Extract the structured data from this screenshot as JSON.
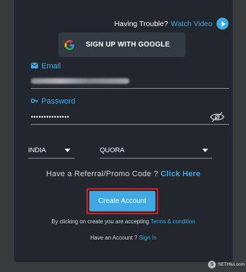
{
  "header": {
    "trouble_text": "Having Trouble?",
    "watch_link": "Watch Video"
  },
  "google_button": {
    "label": "SIGN UP WITH GOOGLE"
  },
  "email": {
    "label": "Email",
    "value_blurred": true
  },
  "password": {
    "label": "Password",
    "value": "•••••••••••••••"
  },
  "country_select": {
    "selected": "INDIA"
  },
  "source_select": {
    "selected": "QUORA"
  },
  "referral": {
    "prompt": "Have a Referral/Promo Code ?",
    "link": "Click Here"
  },
  "create_button": {
    "label": "Create Account"
  },
  "terms": {
    "prefix": "By clicking on create you are accepting",
    "link": "Terms & condition"
  },
  "signin": {
    "prefix": "Have an Account ?",
    "link": "Sign In"
  },
  "watermark": {
    "text": "SETHlui.com"
  },
  "colors": {
    "accent": "#3fa9e6",
    "panel": "#22272d",
    "background": "#383a3c",
    "highlight": "#e01b1b"
  }
}
